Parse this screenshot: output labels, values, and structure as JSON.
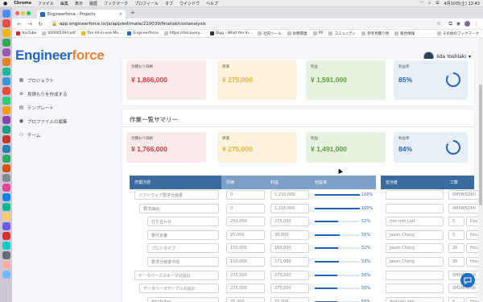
{
  "mac_menu": {
    "app": "Chrome",
    "items": [
      "ファイル",
      "編集",
      "表示",
      "履歴",
      "ブックマーク",
      "プロフィール",
      "タブ",
      "ウインドウ",
      "ヘルプ"
    ],
    "datetime": "4月10日(土) 12:43"
  },
  "browser": {
    "tab_title": "Engineerforce - Projects",
    "url": "app.engineerforce.io/ja/app/estimate/210039/finalize/costanalysis",
    "bookmarks": [
      "YouTube",
      "000005394.pdf",
      "The All-in-one Ma...",
      "Engineerforce",
      "https://discovery....",
      "Digg - What the In...",
      "社内ツール",
      "財務関連",
      "PR",
      "コミュニティ",
      "参考見積り例",
      "競合情報"
    ],
    "other_bookmarks": "その他のブックマーク"
  },
  "app": {
    "logo_part1": "Engineer",
    "logo_part2": "force",
    "user_name": "Iida Yoshiaki",
    "nav": [
      {
        "label": "プロジェクト",
        "icon": "projects-icon"
      },
      {
        "label": "見積もりを作成する",
        "icon": "create-estimate-icon"
      },
      {
        "label": "テンプレート",
        "icon": "template-icon"
      },
      {
        "label": "プロファイルの編集",
        "icon": "profile-icon"
      },
      {
        "label": "チーム",
        "icon": "team-icon"
      }
    ]
  },
  "summary_top": {
    "estimate_label": "見積もり価格",
    "estimate_value": "¥ 1,866,000",
    "cost_label": "原価",
    "cost_value": "¥ 275,000",
    "profit_label": "利益",
    "profit_value": "¥ 1,591,000",
    "margin_label": "利益率",
    "margin_value": "85%",
    "margin_fraction": 0.85
  },
  "work_summary": {
    "title": "作業一覧サマリー",
    "estimate_label": "見積もり価格",
    "estimate_value": "¥ 1,766,000",
    "cost_label": "原価",
    "cost_value": "¥ 275,000",
    "profit_label": "利益",
    "profit_value": "¥ 1,491,000",
    "margin_label": "利益率",
    "margin_value": "84%",
    "margin_fraction": 0.84
  },
  "table": {
    "headers": {
      "task": "作業内容",
      "cost": "原価",
      "profit": "利益",
      "margin": "利益率",
      "assignee": "担当者",
      "effort": "工数"
    },
    "rows": [
      {
        "task": "ソフトウェア要求仕様書",
        "cost": "0",
        "profit": "1,216,000",
        "margin": "100%",
        "margin_fraction": 1.0,
        "assignee": "",
        "effort_num": "",
        "effort_unit": "0M0W5D6h"
      },
      {
        "task": "要求抽出",
        "cost": "0",
        "profit": "1,216,000",
        "margin": "100%",
        "margin_fraction": 1.0,
        "assignee": "",
        "effort_num": "",
        "effort_unit": "0M0W5D6h"
      },
      {
        "task": "打ち合わせ",
        "cost": "250,000",
        "profit": "275,000",
        "margin": "52%",
        "margin_fraction": 0.52,
        "assignee": "min min Latt",
        "effort_num": "5",
        "effort_unit": "Day"
      },
      {
        "task": "要件定義",
        "cost": "25,000",
        "profit": "30,000",
        "margin": "55%",
        "margin_fraction": 0.55,
        "assignee": "Jason Chang",
        "effort_num": "5",
        "effort_unit": "Hours"
      },
      {
        "task": "プロトタイプ",
        "cost": "150,000",
        "profit": "165,000",
        "margin": "52%",
        "margin_fraction": 0.52,
        "assignee": "Jason Chang",
        "effort_num": "30",
        "effort_unit": "Hours"
      },
      {
        "task": "要求仕様書作成",
        "cost": "150,000",
        "profit": "171,000",
        "margin": "53%",
        "margin_fraction": 0.53,
        "assignee": "Jason Chang",
        "effort_num": "30",
        "effort_unit": "Hours"
      },
      {
        "task": "データベーススキーマの設計",
        "cost": "275,000",
        "profit": "275,000",
        "margin": "50%",
        "margin_fraction": 0.5,
        "assignee": "",
        "effort_num": "",
        "effort_unit": "0M0W5D0h"
      },
      {
        "task": "データベーステーブルの設計",
        "cost": "275,000",
        "profit": "275,000",
        "margin": "50%",
        "margin_fraction": 0.5,
        "assignee": "",
        "effort_num": "",
        "effort_unit": "0M0W5D0h"
      },
      {
        "task": "Attributes",
        "cost": "25,000",
        "profit": "25,000",
        "margin": "50%",
        "margin_fraction": 0.5,
        "assignee": "Yoshiaki Iida",
        "effort_num": "5",
        "effort_unit": "Hours"
      }
    ]
  }
}
